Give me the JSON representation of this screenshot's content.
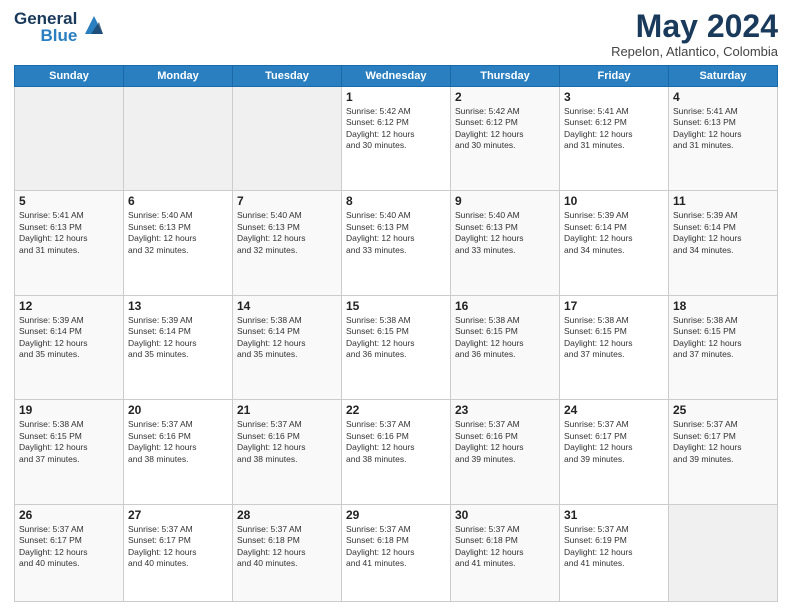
{
  "logo": {
    "general": "General",
    "blue": "Blue"
  },
  "header": {
    "month": "May 2024",
    "location": "Repelon, Atlantico, Colombia"
  },
  "weekdays": [
    "Sunday",
    "Monday",
    "Tuesday",
    "Wednesday",
    "Thursday",
    "Friday",
    "Saturday"
  ],
  "weeks": [
    [
      {
        "day": "",
        "info": ""
      },
      {
        "day": "",
        "info": ""
      },
      {
        "day": "",
        "info": ""
      },
      {
        "day": "1",
        "info": "Sunrise: 5:42 AM\nSunset: 6:12 PM\nDaylight: 12 hours\nand 30 minutes."
      },
      {
        "day": "2",
        "info": "Sunrise: 5:42 AM\nSunset: 6:12 PM\nDaylight: 12 hours\nand 30 minutes."
      },
      {
        "day": "3",
        "info": "Sunrise: 5:41 AM\nSunset: 6:12 PM\nDaylight: 12 hours\nand 31 minutes."
      },
      {
        "day": "4",
        "info": "Sunrise: 5:41 AM\nSunset: 6:13 PM\nDaylight: 12 hours\nand 31 minutes."
      }
    ],
    [
      {
        "day": "5",
        "info": "Sunrise: 5:41 AM\nSunset: 6:13 PM\nDaylight: 12 hours\nand 31 minutes."
      },
      {
        "day": "6",
        "info": "Sunrise: 5:40 AM\nSunset: 6:13 PM\nDaylight: 12 hours\nand 32 minutes."
      },
      {
        "day": "7",
        "info": "Sunrise: 5:40 AM\nSunset: 6:13 PM\nDaylight: 12 hours\nand 32 minutes."
      },
      {
        "day": "8",
        "info": "Sunrise: 5:40 AM\nSunset: 6:13 PM\nDaylight: 12 hours\nand 33 minutes."
      },
      {
        "day": "9",
        "info": "Sunrise: 5:40 AM\nSunset: 6:13 PM\nDaylight: 12 hours\nand 33 minutes."
      },
      {
        "day": "10",
        "info": "Sunrise: 5:39 AM\nSunset: 6:14 PM\nDaylight: 12 hours\nand 34 minutes."
      },
      {
        "day": "11",
        "info": "Sunrise: 5:39 AM\nSunset: 6:14 PM\nDaylight: 12 hours\nand 34 minutes."
      }
    ],
    [
      {
        "day": "12",
        "info": "Sunrise: 5:39 AM\nSunset: 6:14 PM\nDaylight: 12 hours\nand 35 minutes."
      },
      {
        "day": "13",
        "info": "Sunrise: 5:39 AM\nSunset: 6:14 PM\nDaylight: 12 hours\nand 35 minutes."
      },
      {
        "day": "14",
        "info": "Sunrise: 5:38 AM\nSunset: 6:14 PM\nDaylight: 12 hours\nand 35 minutes."
      },
      {
        "day": "15",
        "info": "Sunrise: 5:38 AM\nSunset: 6:15 PM\nDaylight: 12 hours\nand 36 minutes."
      },
      {
        "day": "16",
        "info": "Sunrise: 5:38 AM\nSunset: 6:15 PM\nDaylight: 12 hours\nand 36 minutes."
      },
      {
        "day": "17",
        "info": "Sunrise: 5:38 AM\nSunset: 6:15 PM\nDaylight: 12 hours\nand 37 minutes."
      },
      {
        "day": "18",
        "info": "Sunrise: 5:38 AM\nSunset: 6:15 PM\nDaylight: 12 hours\nand 37 minutes."
      }
    ],
    [
      {
        "day": "19",
        "info": "Sunrise: 5:38 AM\nSunset: 6:15 PM\nDaylight: 12 hours\nand 37 minutes."
      },
      {
        "day": "20",
        "info": "Sunrise: 5:37 AM\nSunset: 6:16 PM\nDaylight: 12 hours\nand 38 minutes."
      },
      {
        "day": "21",
        "info": "Sunrise: 5:37 AM\nSunset: 6:16 PM\nDaylight: 12 hours\nand 38 minutes."
      },
      {
        "day": "22",
        "info": "Sunrise: 5:37 AM\nSunset: 6:16 PM\nDaylight: 12 hours\nand 38 minutes."
      },
      {
        "day": "23",
        "info": "Sunrise: 5:37 AM\nSunset: 6:16 PM\nDaylight: 12 hours\nand 39 minutes."
      },
      {
        "day": "24",
        "info": "Sunrise: 5:37 AM\nSunset: 6:17 PM\nDaylight: 12 hours\nand 39 minutes."
      },
      {
        "day": "25",
        "info": "Sunrise: 5:37 AM\nSunset: 6:17 PM\nDaylight: 12 hours\nand 39 minutes."
      }
    ],
    [
      {
        "day": "26",
        "info": "Sunrise: 5:37 AM\nSunset: 6:17 PM\nDaylight: 12 hours\nand 40 minutes."
      },
      {
        "day": "27",
        "info": "Sunrise: 5:37 AM\nSunset: 6:17 PM\nDaylight: 12 hours\nand 40 minutes."
      },
      {
        "day": "28",
        "info": "Sunrise: 5:37 AM\nSunset: 6:18 PM\nDaylight: 12 hours\nand 40 minutes."
      },
      {
        "day": "29",
        "info": "Sunrise: 5:37 AM\nSunset: 6:18 PM\nDaylight: 12 hours\nand 41 minutes."
      },
      {
        "day": "30",
        "info": "Sunrise: 5:37 AM\nSunset: 6:18 PM\nDaylight: 12 hours\nand 41 minutes."
      },
      {
        "day": "31",
        "info": "Sunrise: 5:37 AM\nSunset: 6:19 PM\nDaylight: 12 hours\nand 41 minutes."
      },
      {
        "day": "",
        "info": ""
      }
    ]
  ]
}
